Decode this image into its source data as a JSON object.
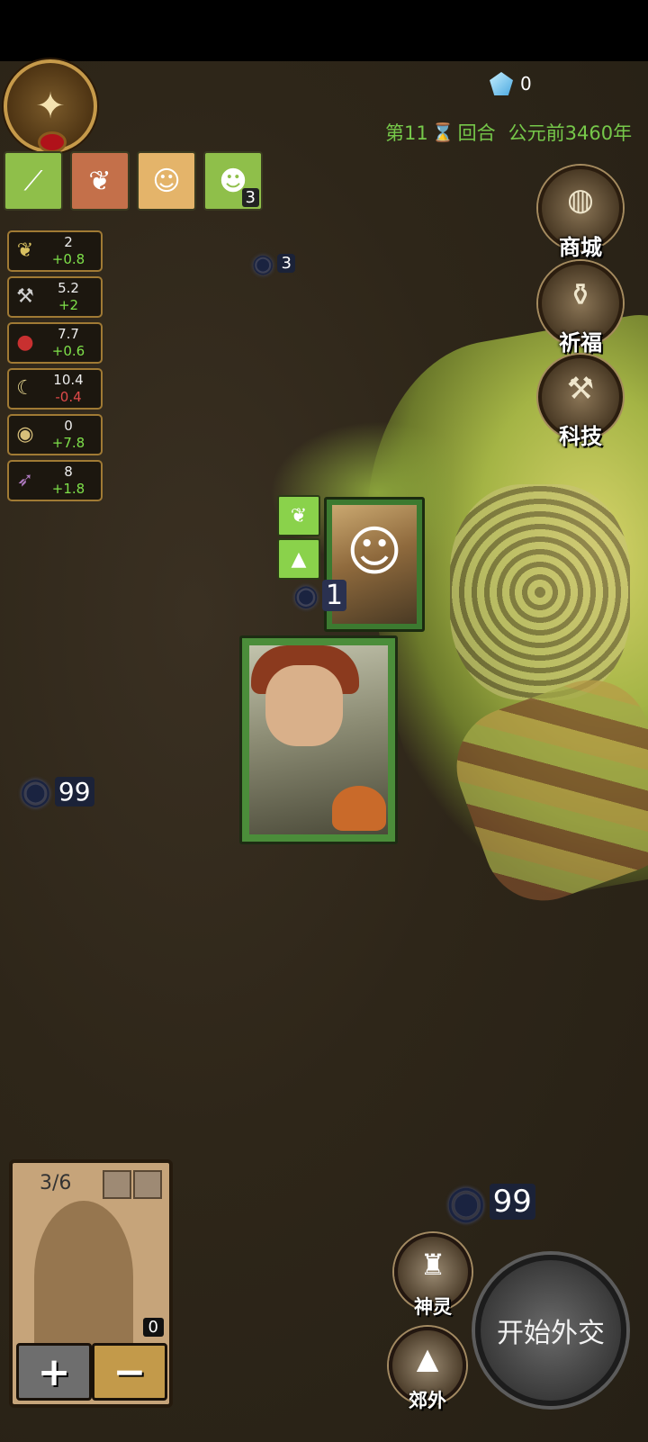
{
  "header": {
    "gems": "0",
    "turn_prefix": "第11",
    "turn_suffix": "回合",
    "era": "公元前3460年"
  },
  "unit_cards": [
    {
      "name": "spear",
      "icon": "spear-icon",
      "color": "#8fbf4a",
      "count": ""
    },
    {
      "name": "wheat",
      "icon": "wheat-icon",
      "color": "#c4704a",
      "count": ""
    },
    {
      "name": "villager",
      "icon": "villager-icon",
      "color": "#e4b46a",
      "count": ""
    },
    {
      "name": "elder",
      "icon": "elder-icon",
      "color": "#8fbf4a",
      "count": "3"
    }
  ],
  "resources": [
    {
      "name": "food",
      "value": "2",
      "delta": "+0.8",
      "sign": "pos",
      "icon": "wheat-icon"
    },
    {
      "name": "tools",
      "value": "5.2",
      "delta": "+2",
      "sign": "pos",
      "icon": "hammer-icon"
    },
    {
      "name": "meat",
      "value": "7.7",
      "delta": "+0.6",
      "sign": "pos",
      "icon": "meat-icon"
    },
    {
      "name": "bone",
      "value": "10.4",
      "delta": "-0.4",
      "sign": "neg",
      "icon": "bone-icon"
    },
    {
      "name": "shell",
      "value": "0",
      "delta": "+7.8",
      "sign": "pos",
      "icon": "shell-icon"
    },
    {
      "name": "feather",
      "value": "8",
      "delta": "+1.8",
      "sign": "pos",
      "icon": "feather-icon"
    }
  ],
  "side_menu": {
    "shop": "商城",
    "pray": "祈福",
    "tech": "科技"
  },
  "eyes": {
    "top": "3",
    "card": "1",
    "left": "99",
    "bottom": "99"
  },
  "slot_panel": {
    "count": "3/6",
    "zero": "0",
    "plus": "+",
    "minus": "−"
  },
  "bottom_buttons": {
    "spirit": "神灵",
    "outskirts": "郊外",
    "diplomacy": "开始外交"
  }
}
